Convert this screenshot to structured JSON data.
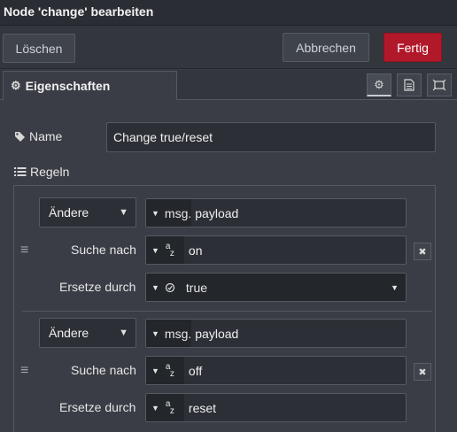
{
  "dialog": {
    "title": "Node 'change' bearbeiten"
  },
  "actions": {
    "delete_label": "Löschen",
    "cancel_label": "Abbrechen",
    "done_label": "Fertig"
  },
  "tabs": {
    "properties_label": "Eigenschaften"
  },
  "form": {
    "name_label": "Name",
    "name_value": "Change true/reset",
    "rules_label": "Regeln"
  },
  "rules": [
    {
      "action": "Ändere",
      "target_prefix": "msg.",
      "target_value": "payload",
      "search_label": "Suche nach",
      "search_value": "on",
      "replace_label": "Ersetze durch",
      "replace_value": "true"
    },
    {
      "action": "Ändere",
      "target_prefix": "msg.",
      "target_value": "payload",
      "search_label": "Suche nach",
      "search_value": "off",
      "replace_label": "Ersetze durch",
      "replace_value": "reset"
    }
  ],
  "icons": {
    "properties_tab": "gear-icon",
    "settings": "gear-icon",
    "description": "document-icon",
    "appearance": "frame-icon",
    "name": "tag-icon",
    "rules": "list-icon",
    "drag": "drag-handle-icon",
    "remove": "close-icon",
    "string_type": "az-icon",
    "boolean_type": "boolean-icon"
  },
  "colors": {
    "accent": "#b1192a",
    "background": "#3a3d45"
  }
}
